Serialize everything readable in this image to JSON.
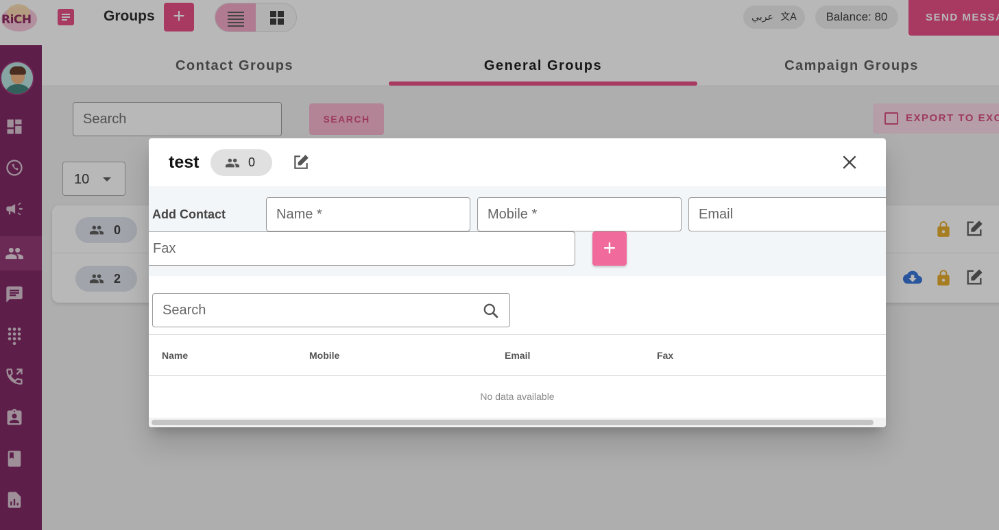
{
  "header": {
    "logo_text": "RiCH",
    "page_title": "Groups",
    "add_label": "+",
    "language_label": "عربي",
    "balance_label": "Balance: 80",
    "send_label": "SEND MESSAGE"
  },
  "sidebar": {
    "items": [
      "dashboard-icon",
      "whatsapp-icon",
      "campaign-icon",
      "groups-icon",
      "messages-icon",
      "dialpad-icon",
      "phone-icon",
      "clipboard-icon",
      "book-icon",
      "reports-icon"
    ],
    "active_item": "groups-icon"
  },
  "tabs": [
    {
      "label": "Contact Groups"
    },
    {
      "label": "General Groups"
    },
    {
      "label": "Campaign Groups"
    }
  ],
  "toolbar": {
    "search_placeholder": "Search",
    "search_button": "SEARCH",
    "export_button": "EXPORT TO EXCEL",
    "per_page": "10"
  },
  "groups": [
    {
      "count": "0"
    },
    {
      "count": "2"
    }
  ],
  "dialog": {
    "title": "test",
    "member_count": "0",
    "add_contact_label": "Add Contact",
    "name_placeholder": "Name *",
    "mobile_placeholder": "Mobile *",
    "email_placeholder": "Email",
    "fax_placeholder": "Fax",
    "add_button": "+",
    "search_placeholder": "Search",
    "columns": [
      "Name",
      "Mobile",
      "Email",
      "Fax"
    ],
    "empty_text": "No data available"
  },
  "colors": {
    "accent": "#e8457e",
    "sidebar": "#7a1c5c",
    "lock": "#e6a823",
    "download": "#2e6fd9"
  }
}
